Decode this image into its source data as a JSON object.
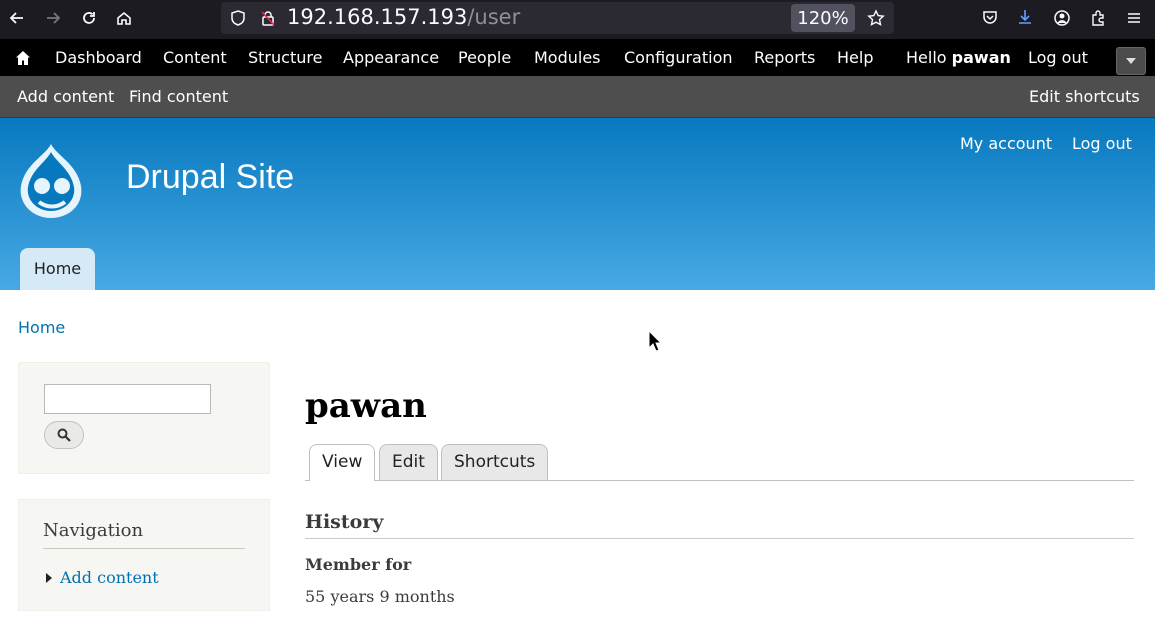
{
  "browser": {
    "url_host": "192.168.157.193",
    "url_path": "/user",
    "zoom": "120%"
  },
  "toolbar": {
    "items": [
      "Dashboard",
      "Content",
      "Structure",
      "Appearance",
      "People",
      "Modules",
      "Configuration",
      "Reports",
      "Help"
    ],
    "hello": "Hello",
    "username": "pawan",
    "logout": "Log out"
  },
  "shortcuts": {
    "add_content": "Add content",
    "find_content": "Find content",
    "edit_shortcuts": "Edit shortcuts"
  },
  "header": {
    "site_name": "Drupal Site",
    "my_account": "My account",
    "logout": "Log out",
    "home_tab": "Home"
  },
  "breadcrumb": {
    "home": "Home"
  },
  "sidebar": {
    "search_value": "",
    "navigation_title": "Navigation",
    "nav_items": [
      "Add content"
    ]
  },
  "main": {
    "title": "pawan",
    "tabs": [
      "View",
      "Edit",
      "Shortcuts"
    ],
    "history_title": "History",
    "member_for_label": "Member for",
    "member_for_value": "55 years 9 months"
  },
  "colors": {
    "toolbar_bg": "#000000",
    "shortcut_bg": "#4e4e4e",
    "header_top": "#0779bf",
    "header_bottom": "#48a9e4",
    "link": "#0071b3"
  }
}
